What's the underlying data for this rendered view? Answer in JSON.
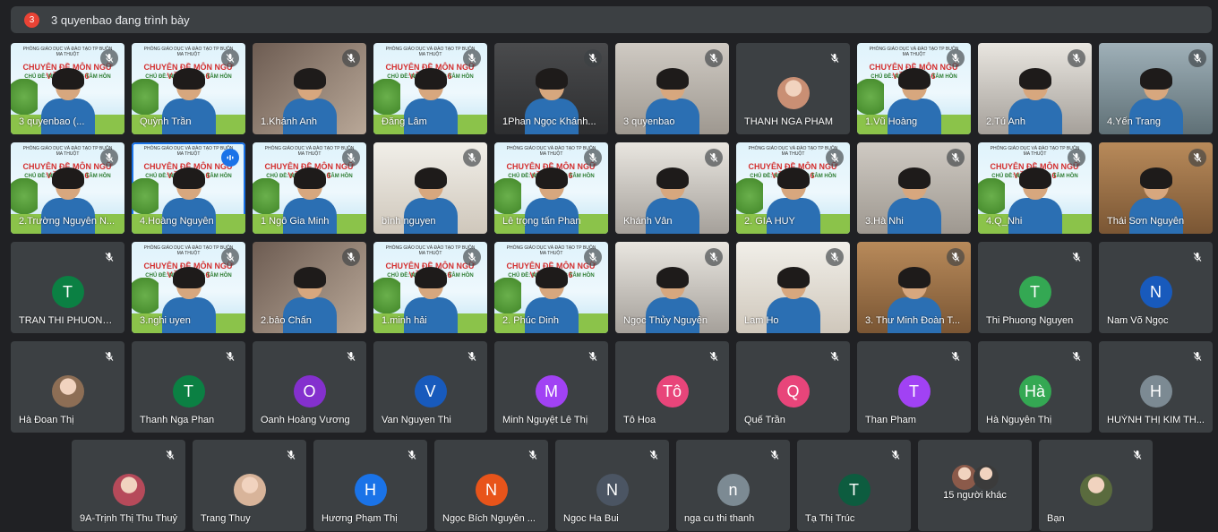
{
  "presenting": {
    "count": "3",
    "title": "3 quyenbao đang trình bày"
  },
  "rows": [
    [
      {
        "name": "3 quyenbao (...",
        "kind": "video",
        "bg": "slide"
      },
      {
        "name": "Quỳnh Trần",
        "kind": "video",
        "bg": "slide"
      },
      {
        "name": "1.Khánh Anh",
        "kind": "video",
        "bg": "room1"
      },
      {
        "name": "Đăng Lâm",
        "kind": "video",
        "bg": "slide"
      },
      {
        "name": "1Phan Ngọc Khánh...",
        "kind": "video",
        "bg": "room7"
      },
      {
        "name": "3 quyenbao",
        "kind": "video",
        "bg": "room2"
      },
      {
        "name": "THANH NGA PHAM",
        "kind": "photo",
        "photo": "#c98f74"
      },
      {
        "name": "1.Vũ Hoàng",
        "kind": "video",
        "bg": "slide"
      },
      {
        "name": "2.Tú Anh",
        "kind": "video",
        "bg": "room6"
      },
      {
        "name": "4.Yến Trang",
        "kind": "video",
        "bg": "room3"
      }
    ],
    [
      {
        "name": "2.Trường Nguyễn N...",
        "kind": "video",
        "bg": "slide"
      },
      {
        "name": "4.Hoàng Nguyễn",
        "kind": "video",
        "bg": "slide",
        "active": true
      },
      {
        "name": "1 Ngô Gia Minh",
        "kind": "video",
        "bg": "slide"
      },
      {
        "name": "bình nguyen",
        "kind": "video",
        "bg": "room4"
      },
      {
        "name": "Lê trọng tấn Phan",
        "kind": "video",
        "bg": "slide"
      },
      {
        "name": "Khánh Vân",
        "kind": "video",
        "bg": "room6"
      },
      {
        "name": "2. GIA HUY",
        "kind": "video",
        "bg": "slide"
      },
      {
        "name": "3.Hà Nhi",
        "kind": "video",
        "bg": "room2"
      },
      {
        "name": "4.Q_Nhi",
        "kind": "video",
        "bg": "slide"
      },
      {
        "name": "Thái Sơn Nguyễn",
        "kind": "video",
        "bg": "room5"
      }
    ],
    [
      {
        "name": "TRAN THI PHUONG ...",
        "kind": "letter",
        "letter": "T",
        "color": "#0b8043"
      },
      {
        "name": "3.nghi uyen",
        "kind": "video",
        "bg": "slide"
      },
      {
        "name": "2.bảo Chấn",
        "kind": "video",
        "bg": "room1"
      },
      {
        "name": "1.minh hải",
        "kind": "video",
        "bg": "slide"
      },
      {
        "name": "2. Phúc Dinh",
        "kind": "video",
        "bg": "slide"
      },
      {
        "name": "Ngọc Thủy Nguyễn",
        "kind": "video",
        "bg": "room6"
      },
      {
        "name": "Lam Ho",
        "kind": "video",
        "bg": "room4"
      },
      {
        "name": "3. Thư Minh Đoàn T...",
        "kind": "video",
        "bg": "room5"
      },
      {
        "name": "Thi Phuong Nguyen",
        "kind": "letter",
        "letter": "T",
        "color": "#34a853"
      },
      {
        "name": "Nam Võ Ngọc",
        "kind": "letter",
        "letter": "N",
        "color": "#185abc"
      }
    ],
    [
      {
        "name": "Hà Đoan Thị",
        "kind": "photo",
        "photo": "#8d6e55"
      },
      {
        "name": "Thanh Nga Phan",
        "kind": "letter",
        "letter": "T",
        "color": "#0b8043"
      },
      {
        "name": "Oanh Hoàng Vương",
        "kind": "letter",
        "letter": "O",
        "color": "#8430ce"
      },
      {
        "name": "Van Nguyen Thi",
        "kind": "letter",
        "letter": "V",
        "color": "#185abc"
      },
      {
        "name": "Minh Nguyệt Lê Thị",
        "kind": "letter",
        "letter": "M",
        "color": "#a142f4"
      },
      {
        "name": "Tô Hoa",
        "kind": "letter",
        "letter": "Tô",
        "color": "#e8457a"
      },
      {
        "name": "Quế Trần",
        "kind": "letter",
        "letter": "Q",
        "color": "#e8457a"
      },
      {
        "name": "Than Pham",
        "kind": "letter",
        "letter": "T",
        "color": "#a142f4"
      },
      {
        "name": "Hà Nguyễn Thị",
        "kind": "letter",
        "letter": "Hà",
        "color": "#34a853"
      },
      {
        "name": "HUỲNH THỊ KIM TH...",
        "kind": "letter",
        "letter": "H",
        "color": "#7c8a93"
      }
    ],
    [
      {
        "name": "9A-Trịnh Thị Thu Thuỷ",
        "kind": "photo",
        "photo": "#b64a5a"
      },
      {
        "name": "Trang Thuy",
        "kind": "photo",
        "photo": "#d8b49a"
      },
      {
        "name": "Hương Phạm Thị",
        "kind": "letter",
        "letter": "H",
        "color": "#1a73e8"
      },
      {
        "name": "Ngọc Bích Nguyễn ...",
        "kind": "letter",
        "letter": "N",
        "color": "#e8541a"
      },
      {
        "name": "Ngoc Ha Bui",
        "kind": "letter",
        "letter": "N",
        "color": "#4b5563"
      },
      {
        "name": "nga cu thi thanh",
        "kind": "letter",
        "letter": "n",
        "color": "#7c8a93"
      },
      {
        "name": "Tạ Thị Trúc",
        "kind": "letter",
        "letter": "T",
        "color": "#0d5c3f"
      },
      {
        "name": "15 người khác",
        "kind": "others"
      },
      {
        "name": "Bạn",
        "kind": "photo",
        "photo": "#5a6b3e"
      }
    ]
  ],
  "slide_text": {
    "header": "PHÒNG GIÁO DỤC VÀ ĐÀO TẠO TP BUÔN MA THUỘT",
    "title": "CHUYÊN ĐỀ MÔN NGỮ VĂN LỚP 6",
    "sub": "CHỦ ĐỀ: NUÔI DƯỠNG TÂM HỒN"
  },
  "colors": {
    "bg": "#202124",
    "tile": "#3c4043",
    "active": "#1a73e8"
  },
  "icons": {
    "mic_off": "mic-off-icon",
    "mic_active": "speaking-icon"
  }
}
